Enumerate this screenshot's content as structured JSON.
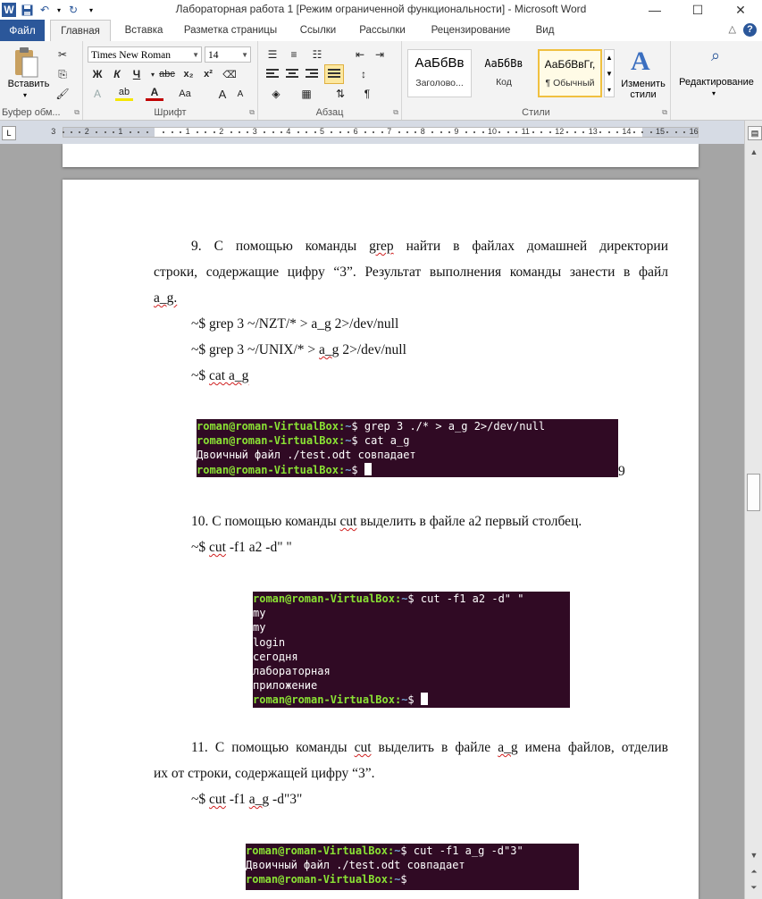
{
  "window": {
    "title": "Лабораторная работа 1 [Режим ограниченной функциональности]  -  Microsoft Word",
    "minimize": "—",
    "maximize": "☐",
    "close": "✕"
  },
  "tabs": {
    "file": "Файл",
    "items": [
      "Главная",
      "Вставка",
      "Разметка страницы",
      "Ссылки",
      "Рассылки",
      "Рецензирование",
      "Вид"
    ]
  },
  "ribbon": {
    "clipboard": {
      "paste_label": "Вставить",
      "group_label": "Буфер обм..."
    },
    "font": {
      "font_name": "Times New Roman",
      "font_size": "14",
      "bold": "Ж",
      "italic": "К",
      "underline": "Ч",
      "strike": "abc",
      "subscript": "x₂",
      "superscript": "x²",
      "text_effects": "A",
      "highlight": "ab",
      "font_color": "A",
      "change_case": "Aa",
      "grow": "A",
      "shrink": "A",
      "group_label": "Шрифт"
    },
    "paragraph": {
      "group_label": "Абзац"
    },
    "styles": {
      "items": [
        {
          "sample": "АаБбВв",
          "name": "Заголово..."
        },
        {
          "sample": "АаБбВв",
          "name": "Код"
        },
        {
          "sample": "АаБбВвГг,",
          "name": "¶ Обычный"
        }
      ],
      "change_styles": "Изменить стили",
      "group_label": "Стили"
    },
    "editing": {
      "label": "Редактирование"
    }
  },
  "ruler": {
    "numbers": [
      "3",
      "2",
      "1",
      "1",
      "2",
      "3",
      "4",
      "5",
      "6",
      "7",
      "8",
      "9",
      "10",
      "11",
      "12",
      "13",
      "14",
      "15",
      "16"
    ]
  },
  "document": {
    "p9_line1": "9. С помощью команды grep найти в файлах домашней директории",
    "p9_line2": "строки, содержащие цифру “3”. Результат выполнения команды занести в файл",
    "p9_line3": "a_g.",
    "cmd9_1": "~$ grep 3 ~/NZT/* > a_g 2>/dev/null",
    "cmd9_2": "~$ grep 3 ~/UNIX/* > a_g 2>/dev/null",
    "cmd9_3": "~$ cat a_g",
    "stray_9": "9",
    "p10_line1": "10. С помощью команды cut выделить в файле a2 первый столбец.",
    "cmd10": "~$ cut -f1 a2 -d\" \"",
    "p11_line1": "11. С помощью команды cut выделить в файле a_g имена файлов, отделив",
    "p11_line2": "их от строки, содержащей цифру “3”.",
    "cmd11": "~$ cut -f1 a_g -d\"3\""
  },
  "terminal1": {
    "lines": [
      {
        "user": "roman@roman-VirtualBox",
        "path": "~",
        "cmd": "$ grep 3 ./* > a_g 2>/dev/null"
      },
      {
        "user": "roman@roman-VirtualBox",
        "path": "~",
        "cmd": "$ cat a_g"
      },
      {
        "out": "Двоичный файл ./test.odt совпадает"
      },
      {
        "user": "roman@roman-VirtualBox",
        "path": "~",
        "cmd": "$ ",
        "cursor": true
      }
    ]
  },
  "terminal2": {
    "lines": [
      {
        "user": "roman@roman-VirtualBox",
        "path": "~",
        "cmd": "$ cut -f1 a2 -d\" \""
      },
      {
        "out": "my"
      },
      {
        "out": "my"
      },
      {
        "out": "login"
      },
      {
        "out": "сегодня"
      },
      {
        "out": "лабораторная"
      },
      {
        "out": "приложение"
      },
      {
        "user": "roman@roman-VirtualBox",
        "path": "~",
        "cmd": "$ ",
        "cursor": true
      }
    ]
  },
  "terminal3": {
    "lines": [
      {
        "user": "roman@roman-VirtualBox",
        "path": "~",
        "cmd": "$ cut -f1 a_g -d\"3\""
      },
      {
        "out": "Двоичный файл ./test.odt совпадает"
      },
      {
        "user": "roman@roman-VirtualBox",
        "path": "~",
        "cmd": "$"
      }
    ]
  },
  "colors": {
    "accent": "#2b579a",
    "terminal_bg": "#300a24",
    "prompt_green": "#8ae234",
    "prompt_blue": "#729fcf",
    "spell_red": "#d02020"
  }
}
